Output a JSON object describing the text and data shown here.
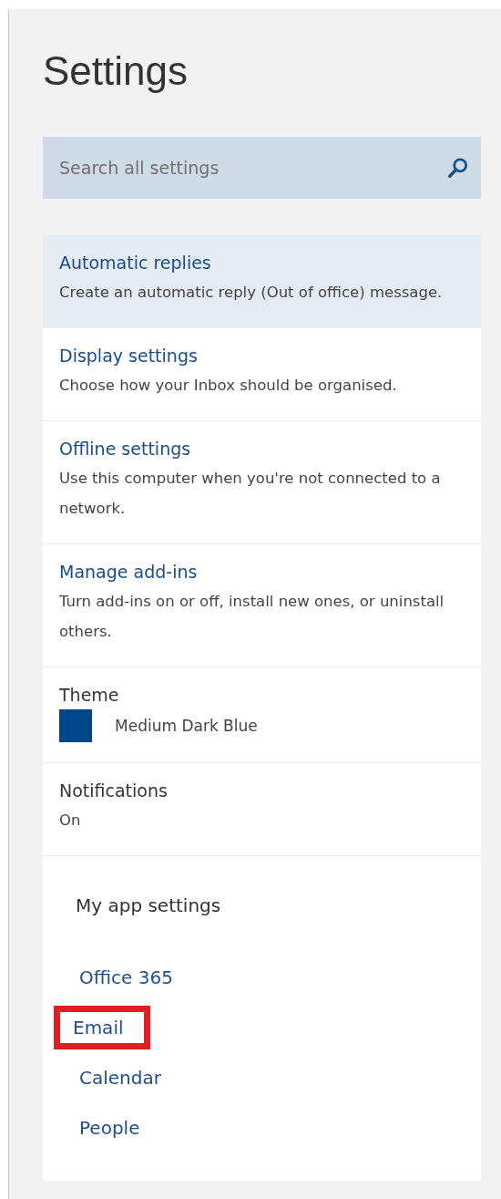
{
  "title": "Settings",
  "search": {
    "placeholder": "Search all settings"
  },
  "items": [
    {
      "kind": "link",
      "title": "Automatic replies",
      "description": "Create an automatic reply (Out of office) message.",
      "selected": true
    },
    {
      "kind": "link",
      "title": "Display settings",
      "description": "Choose how your Inbox should be organised.",
      "selected": false
    },
    {
      "kind": "link",
      "title": "Offline settings",
      "description": "Use this computer when you're not connected to a network.",
      "selected": false
    },
    {
      "kind": "link",
      "title": "Manage add-ins",
      "description": "Turn add-ins on or off, install new ones, or uninstall others.",
      "selected": false
    },
    {
      "kind": "theme",
      "title": "Theme",
      "value": "Medium Dark Blue",
      "color": "#00468b",
      "selected": false
    },
    {
      "kind": "value",
      "title": "Notifications",
      "value": "On",
      "selected": false
    }
  ],
  "app_settings": {
    "heading": "My app settings",
    "links": [
      {
        "label": "Office 365",
        "highlighted": false
      },
      {
        "label": "Email",
        "highlighted": true
      },
      {
        "label": "Calendar",
        "highlighted": false
      },
      {
        "label": "People",
        "highlighted": false
      }
    ]
  }
}
